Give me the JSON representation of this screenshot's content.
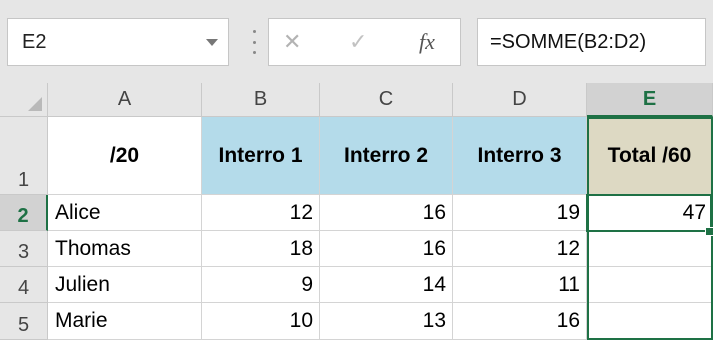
{
  "formula_bar": {
    "name_box": "E2",
    "cancel_icon": "close-icon",
    "enter_icon": "checkmark-icon",
    "fx_label": "fx",
    "formula": "=SOMME(B2:D2)"
  },
  "columns": [
    "A",
    "B",
    "C",
    "D",
    "E"
  ],
  "rows": [
    "1",
    "2",
    "3",
    "4",
    "5"
  ],
  "header_row": {
    "a": "/20",
    "b": "Interro 1",
    "c": "Interro 2",
    "d": "Interro 3",
    "e": "Total /60"
  },
  "data_rows": [
    {
      "name": "Alice",
      "b": "12",
      "c": "16",
      "d": "19",
      "e": "47"
    },
    {
      "name": "Thomas",
      "b": "18",
      "c": "16",
      "d": "12",
      "e": ""
    },
    {
      "name": "Julien",
      "b": "9",
      "c": "14",
      "d": "11",
      "e": ""
    },
    {
      "name": "Marie",
      "b": "10",
      "c": "13",
      "d": "16",
      "e": ""
    }
  ],
  "colors": {
    "header_blue": "#b4dbea",
    "header_tan": "#ddd9c3",
    "selection_green": "#1e7145"
  }
}
